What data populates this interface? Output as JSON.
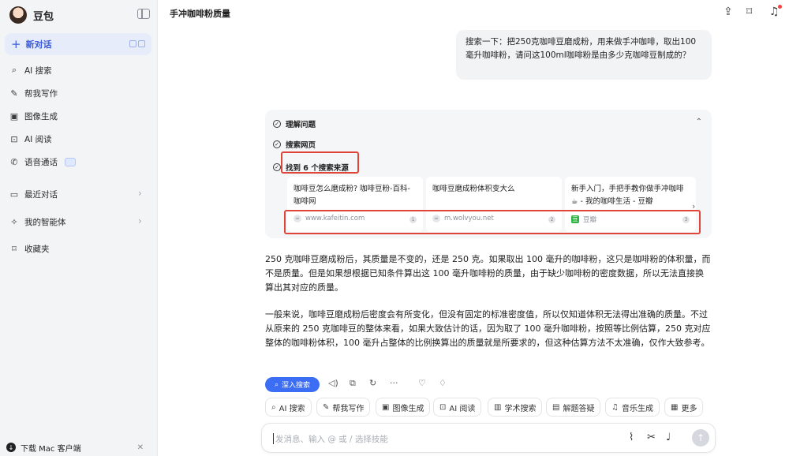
{
  "sidebar": {
    "brand": "豆包",
    "new_chat": "新对话",
    "items": [
      {
        "label": "AI 搜索",
        "icon": "search-icon"
      },
      {
        "label": "帮我写作",
        "icon": "pen-icon"
      },
      {
        "label": "图像生成",
        "icon": "image-icon"
      },
      {
        "label": "AI 阅读",
        "icon": "reader-icon"
      },
      {
        "label": "语音通话",
        "icon": "phone-icon"
      },
      {
        "label": "最近对话",
        "icon": "chat-bubble-icon"
      },
      {
        "label": "我的智能体",
        "icon": "sparkle-icon"
      },
      {
        "label": "收藏夹",
        "icon": "bookmark-icon"
      }
    ],
    "download": "下载 Mac 客户端"
  },
  "header": {
    "title": "手冲咖啡粉质量"
  },
  "user_message": "搜索一下：把250克咖啡豆磨成粉，用来做手冲咖啡，取出100毫升咖啡粉，请问这100ml咖啡粉是由多少克咖啡豆制成的？",
  "search": {
    "steps": [
      "理解问题",
      "搜索网页",
      "找到 6 个搜索来源"
    ],
    "sources": [
      {
        "title": "咖啡豆怎么磨成粉? 咖啡豆粉-百科-咖啡网",
        "site": "www.kafeitin.com",
        "num": "1"
      },
      {
        "title": "咖啡豆磨成粉体积变大么",
        "site": "m.wolvyou.net",
        "num": "2"
      },
      {
        "title": "新手入门，手把手教你做手冲咖啡☕ - 我的咖啡生活 - 豆瓣",
        "site": "豆瓣",
        "num": "3"
      }
    ]
  },
  "answer": {
    "p1": "250 克咖啡豆磨成粉后，其质量是不变的，还是 250 克。如果取出 100 毫升的咖啡粉，这只是咖啡粉的体积量，而不是质量。但是如果想根据已知条件算出这 100 毫升咖啡粉的质量，由于缺少咖啡粉的密度数据，所以无法直接换算出其对应的质量。",
    "p2": "一般来说，咖啡豆磨成粉后密度会有所变化，但没有固定的标准密度值，所以仅知道体积无法得出准确的质量。不过从原来的 250 克咖啡豆的整体来看，如果大致估计的话，因为取了 100 毫升咖啡粉，按照等比例估算，250 克对应整体的咖啡粉体积，100 毫升占整体的比例换算出的质量就是所要求的，但这种估算方法不太准确，仅作大致参考。"
  },
  "actions": {
    "deep_search": "深入搜索"
  },
  "skills": [
    "AI 搜索",
    "帮我写作",
    "图像生成",
    "AI 阅读",
    "学术搜索",
    "解题答疑",
    "音乐生成",
    "更多"
  ],
  "input": {
    "placeholder": "发消息、输入 @ 或 / 选择技能"
  }
}
